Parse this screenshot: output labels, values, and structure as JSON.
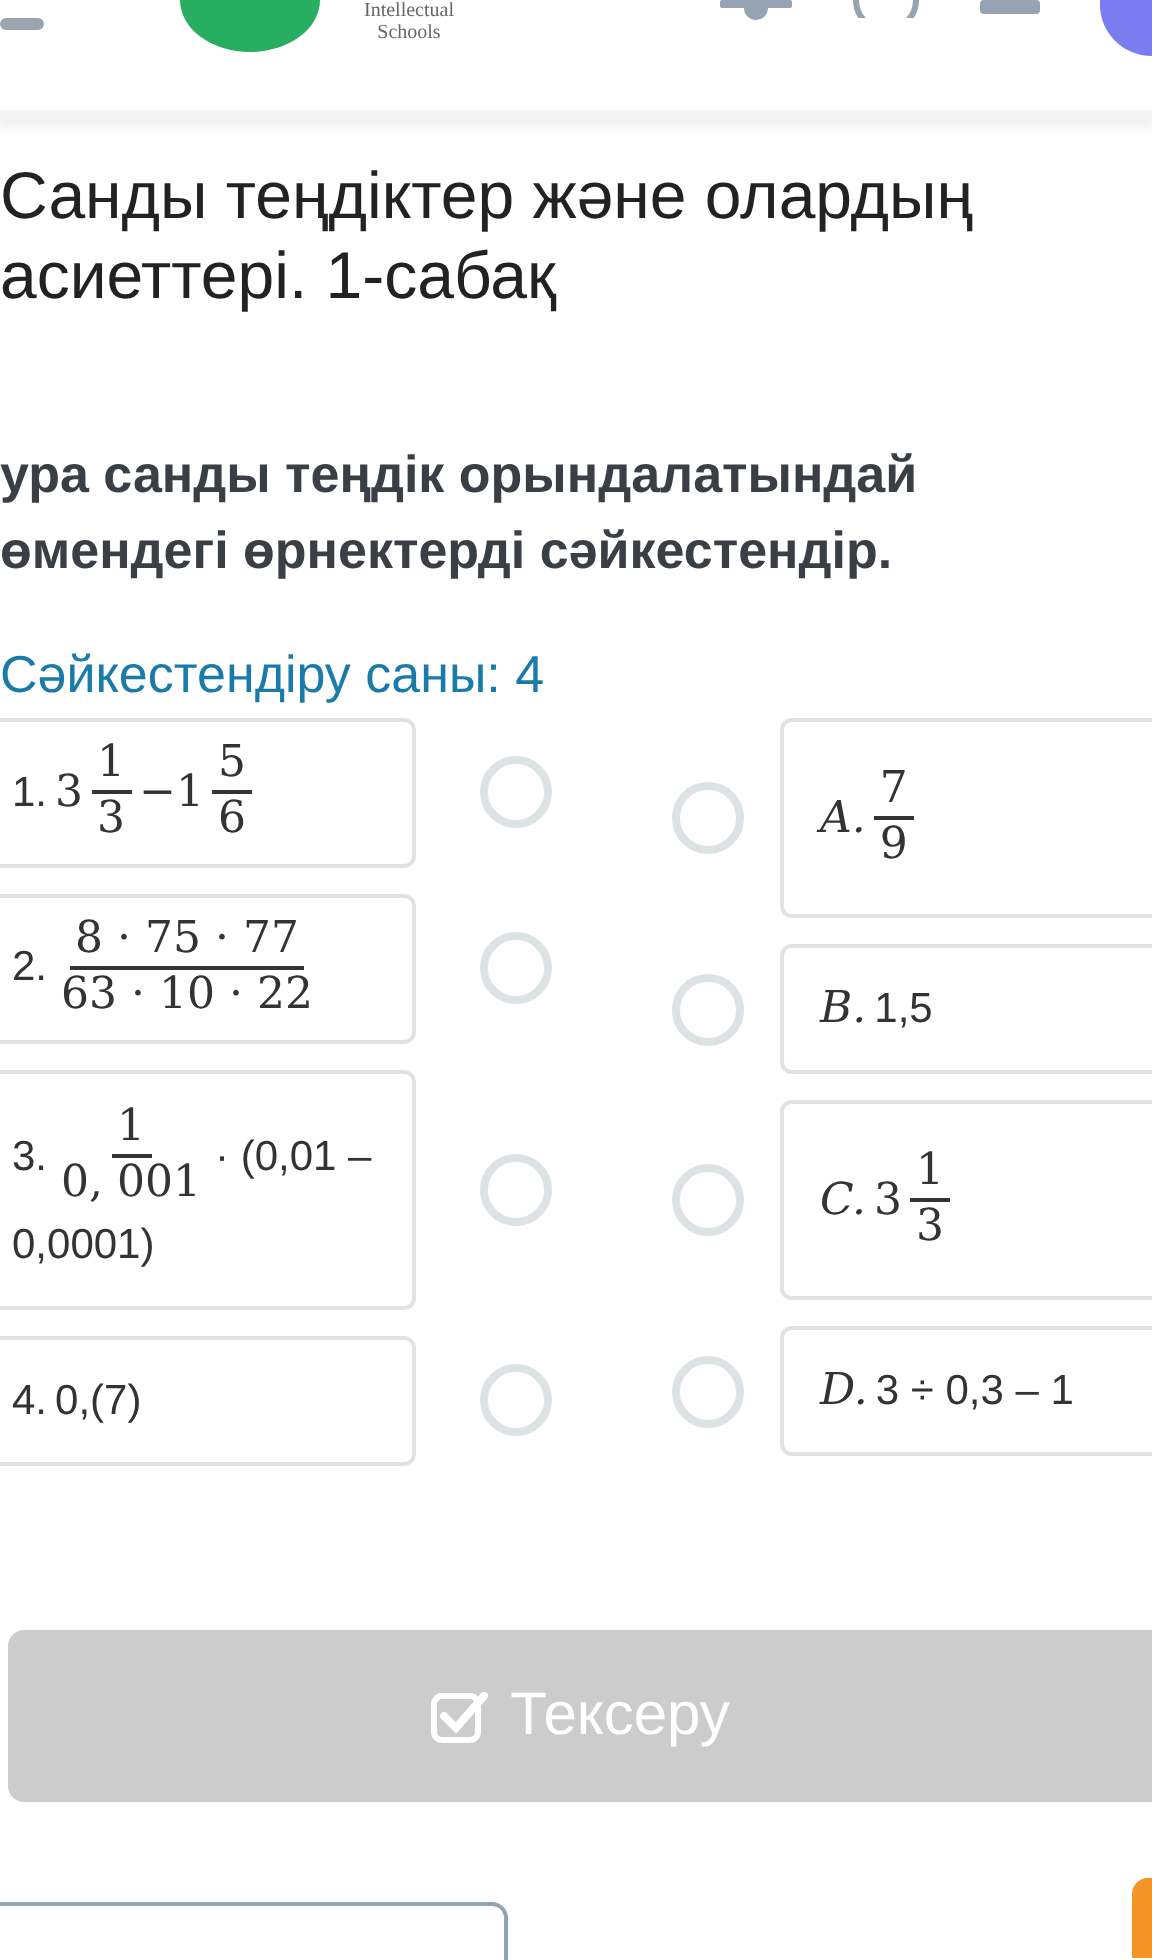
{
  "header": {
    "logo_lines": [
      "Intellectual",
      "Schools"
    ]
  },
  "title": "Санды теңдіктер және олардың асиеттері. 1-сабақ",
  "instruction": "ура санды теңдік орындалатындай өмендегі өрнектерді сәйкестендір.",
  "match_count": "Сәйкестендіру саны: 4",
  "left_items": [
    {
      "label": "1.",
      "selected": false,
      "parts": [
        {
          "kind": "mixed",
          "whole": "3",
          "num": "1",
          "den": "3"
        },
        {
          "kind": "math",
          "text": "−1"
        },
        {
          "kind": "frac",
          "num": "5",
          "den": "6"
        }
      ]
    },
    {
      "label": "2.",
      "selected": false,
      "parts": [
        {
          "kind": "frac",
          "num": "8 · 75 · 77",
          "den": "63 · 10 · 22"
        }
      ]
    },
    {
      "label": "3.",
      "selected": false,
      "parts": [
        {
          "kind": "frac",
          "num": "1",
          "den": "0, 001"
        },
        {
          "kind": "plain",
          "text": "· (0,01 – 0,0001)"
        }
      ]
    },
    {
      "label": "4.",
      "selected": false,
      "parts": [
        {
          "kind": "plain",
          "text": "0,(7)"
        }
      ]
    }
  ],
  "right_items": [
    {
      "label": "A.",
      "selected": false,
      "parts": [
        {
          "kind": "frac",
          "num": "7",
          "den": "9"
        }
      ]
    },
    {
      "label": "B.",
      "selected": false,
      "parts": [
        {
          "kind": "plain",
          "text": "1,5"
        }
      ]
    },
    {
      "label": "C.",
      "selected": false,
      "parts": [
        {
          "kind": "mixed",
          "whole": "3",
          "num": "1",
          "den": "3"
        }
      ]
    },
    {
      "label": "D.",
      "selected": false,
      "parts": [
        {
          "kind": "plain",
          "text": "3 ÷ 0,3 – 1"
        }
      ]
    }
  ],
  "check_button": {
    "label": "Тексеру",
    "disabled": true
  }
}
